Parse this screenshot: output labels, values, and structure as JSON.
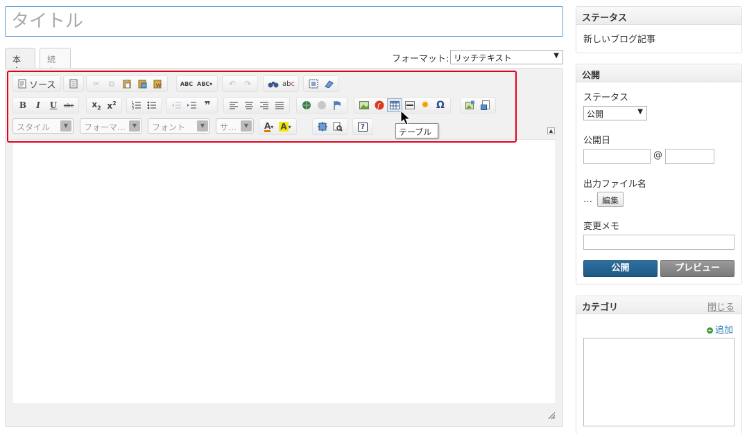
{
  "title": {
    "placeholder": "タイトル"
  },
  "tabs": [
    {
      "label": "本文",
      "active": true
    },
    {
      "label": "続き",
      "active": false
    }
  ],
  "format": {
    "label": "フォーマット:",
    "value": "リッチテキスト"
  },
  "toolbar": {
    "source_label": "ソース",
    "combos": {
      "style": "スタイル",
      "format": "フォーマ…",
      "font": "フォント",
      "size": "サ…"
    },
    "tooltip": "テーブル",
    "row1_icons": [
      "source-icon",
      "template-icon",
      "cut-icon",
      "copy-icon",
      "paste-icon",
      "paste-text-icon",
      "paste-word-icon",
      "spellcheck-icon",
      "spellcheck-as-you-type-icon",
      "undo-icon",
      "redo-icon",
      "find-icon",
      "replace-icon",
      "select-all-icon",
      "remove-format-icon"
    ],
    "row2_icons": [
      "bold-icon",
      "italic-icon",
      "underline-icon",
      "strikethrough-icon",
      "subscript-icon",
      "superscript-icon",
      "numbered-list-icon",
      "bulleted-list-icon",
      "outdent-icon",
      "indent-icon",
      "blockquote-icon",
      "align-left-icon",
      "align-center-icon",
      "align-right-icon",
      "justify-icon",
      "link-icon",
      "unlink-icon",
      "anchor-icon",
      "image-icon",
      "flash-icon",
      "table-icon",
      "horizontal-line-icon",
      "smiley-icon",
      "special-char-icon",
      "insert-asset-icon",
      "insert-media-icon"
    ],
    "row3_icons": [
      "text-color-icon",
      "background-color-icon",
      "maximize-icon",
      "show-blocks-icon",
      "about-icon"
    ]
  },
  "sidebar": {
    "status_panel": {
      "heading": "ステータス",
      "value": "新しいブログ記事"
    },
    "publish_panel": {
      "heading": "公開",
      "status_label": "ステータス",
      "status_value": "公開",
      "date_label": "公開日",
      "at_sign": "@",
      "filename_label": "出力ファイル名",
      "filename_value": "…",
      "edit_button": "編集",
      "memo_label": "変更メモ",
      "publish_button": "公開",
      "preview_button": "プレビュー"
    },
    "category_panel": {
      "heading": "カテゴリ",
      "close_link": "閉じる",
      "add_link": "追加"
    }
  },
  "colors": {
    "accent": "#1e5a85",
    "highlight": "#e0001b",
    "link": "#2a7ab0"
  }
}
